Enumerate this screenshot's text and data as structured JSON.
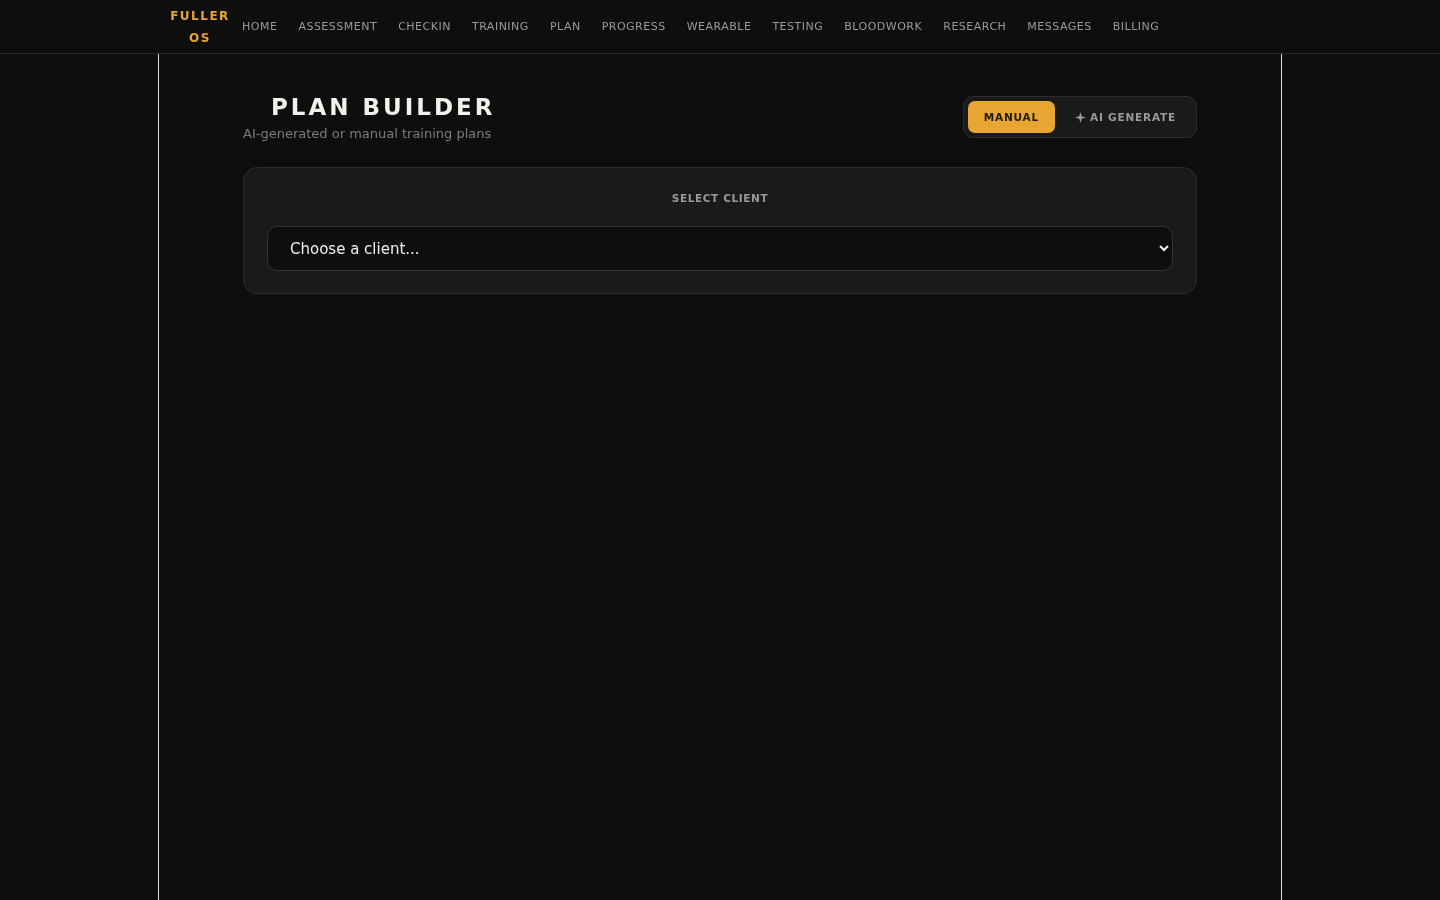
{
  "brand": {
    "line_1": "FULLER",
    "line_2": "OS"
  },
  "nav": [
    {
      "label": "HOME",
      "selected": false
    },
    {
      "label": "ASSESSMENT",
      "selected": false
    },
    {
      "label": "CHECKIN",
      "selected": false
    },
    {
      "label": "TRAINING",
      "selected": false
    },
    {
      "label": "PLAN",
      "selected": false
    },
    {
      "label": "PROGRESS",
      "selected": false
    },
    {
      "label": "WEARABLE",
      "selected": false
    },
    {
      "label": "TESTING",
      "selected": false
    },
    {
      "label": "BLOODWORK",
      "selected": false
    },
    {
      "label": "RESEARCH",
      "selected": false
    },
    {
      "label": "MESSAGES",
      "selected": false
    },
    {
      "label": "BILLING",
      "selected": false
    }
  ],
  "page": {
    "title": "PLAN BUILDER",
    "subtitle": "AI-generated or manual training plans"
  },
  "mode_toggle": [
    {
      "label": "MANUAL",
      "selected": true,
      "kind": "plain"
    },
    {
      "label": "AI GENERATE",
      "selected": false,
      "kind": "ai"
    }
  ],
  "client_card": {
    "label": "SELECT CLIENT",
    "select": {
      "placeholder": "Choose a client..."
    }
  }
}
